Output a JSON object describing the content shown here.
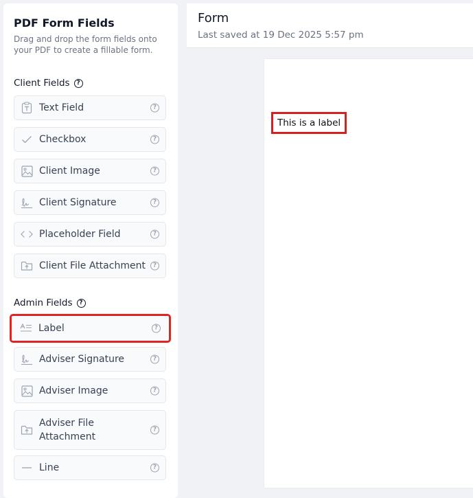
{
  "sidebar": {
    "title": "PDF Form Fields",
    "description": "Drag and drop the form fields onto your PDF to create a fillable form.",
    "client_section": {
      "title": "Client Fields",
      "fields": [
        {
          "label": "Text Field",
          "icon": "text-field-icon"
        },
        {
          "label": "Checkbox",
          "icon": "checkmark-icon"
        },
        {
          "label": "Client Image",
          "icon": "image-icon"
        },
        {
          "label": "Client Signature",
          "icon": "signature-icon"
        },
        {
          "label": "Placeholder Field",
          "icon": "code-brackets-icon"
        },
        {
          "label": "Client File Attachment",
          "icon": "folder-upload-icon"
        }
      ]
    },
    "admin_section": {
      "title": "Admin Fields",
      "fields": [
        {
          "label": "Label",
          "icon": "label-icon",
          "highlighted": true
        },
        {
          "label": "Adviser Signature",
          "icon": "signature-icon"
        },
        {
          "label": "Adviser Image",
          "icon": "image-icon"
        },
        {
          "label": "Adviser File Attachment",
          "icon": "folder-upload-icon"
        },
        {
          "label": "Line",
          "icon": "line-icon"
        }
      ]
    }
  },
  "header": {
    "title": "Form",
    "subtitle": "Last saved at 19 Dec 2025 5:57 pm"
  },
  "canvas": {
    "placed_label": "This is a label"
  },
  "colors": {
    "highlight": "#e02424",
    "background": "#f0f2f5",
    "panel": "#ffffff",
    "field_bg": "#f9fafb"
  }
}
